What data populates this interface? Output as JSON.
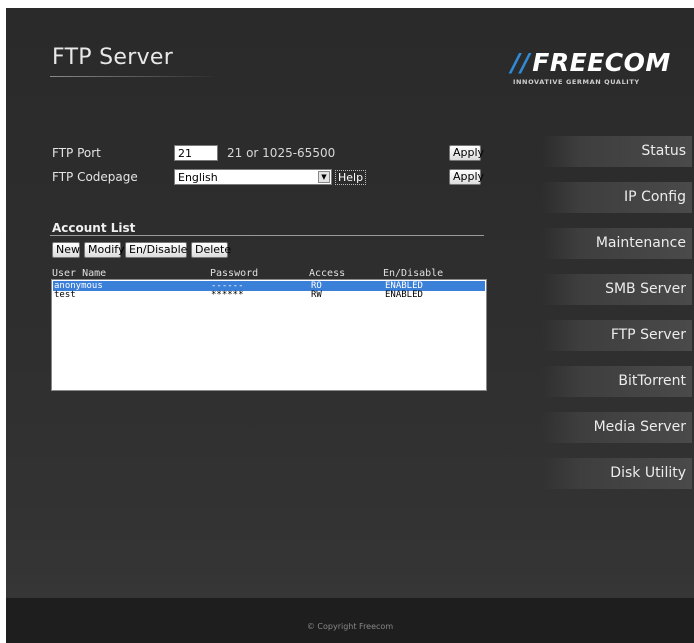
{
  "header": {
    "title": "FTP Server",
    "logo_text": "FREECOM",
    "logo_mark": "//",
    "logo_tagline": "INNOVATIVE GERMAN QUALITY"
  },
  "ftp": {
    "port_label": "FTP Port",
    "port_value": "21",
    "port_hint": "21 or 1025-65500",
    "apply_label": "Apply",
    "codepage_label": "FTP Codepage",
    "codepage_value": "English",
    "help_label": "Help"
  },
  "accounts": {
    "section_title": "Account List",
    "buttons": {
      "new": "New",
      "modify": "Modify",
      "toggle": "En/Disable",
      "delete": "Delete"
    },
    "columns": [
      "User Name",
      "Password",
      "Access",
      "En/Disable"
    ],
    "rows": [
      {
        "user": "anonymous",
        "password": "------",
        "access": "RO",
        "status": "ENABLED",
        "selected": true
      },
      {
        "user": "test",
        "password": "******",
        "access": "RW",
        "status": "ENABLED",
        "selected": false
      }
    ]
  },
  "nav": {
    "items": [
      "Status",
      "IP Config",
      "Maintenance",
      "SMB Server",
      "FTP Server",
      "BitTorrent",
      "Media Server",
      "Disk Utility"
    ]
  },
  "footer": {
    "copyright": "© Copyright Freecom"
  },
  "colors": {
    "accent": "#2f8bd6",
    "selection": "#3a7fd8",
    "background": "#2d2d2d"
  }
}
